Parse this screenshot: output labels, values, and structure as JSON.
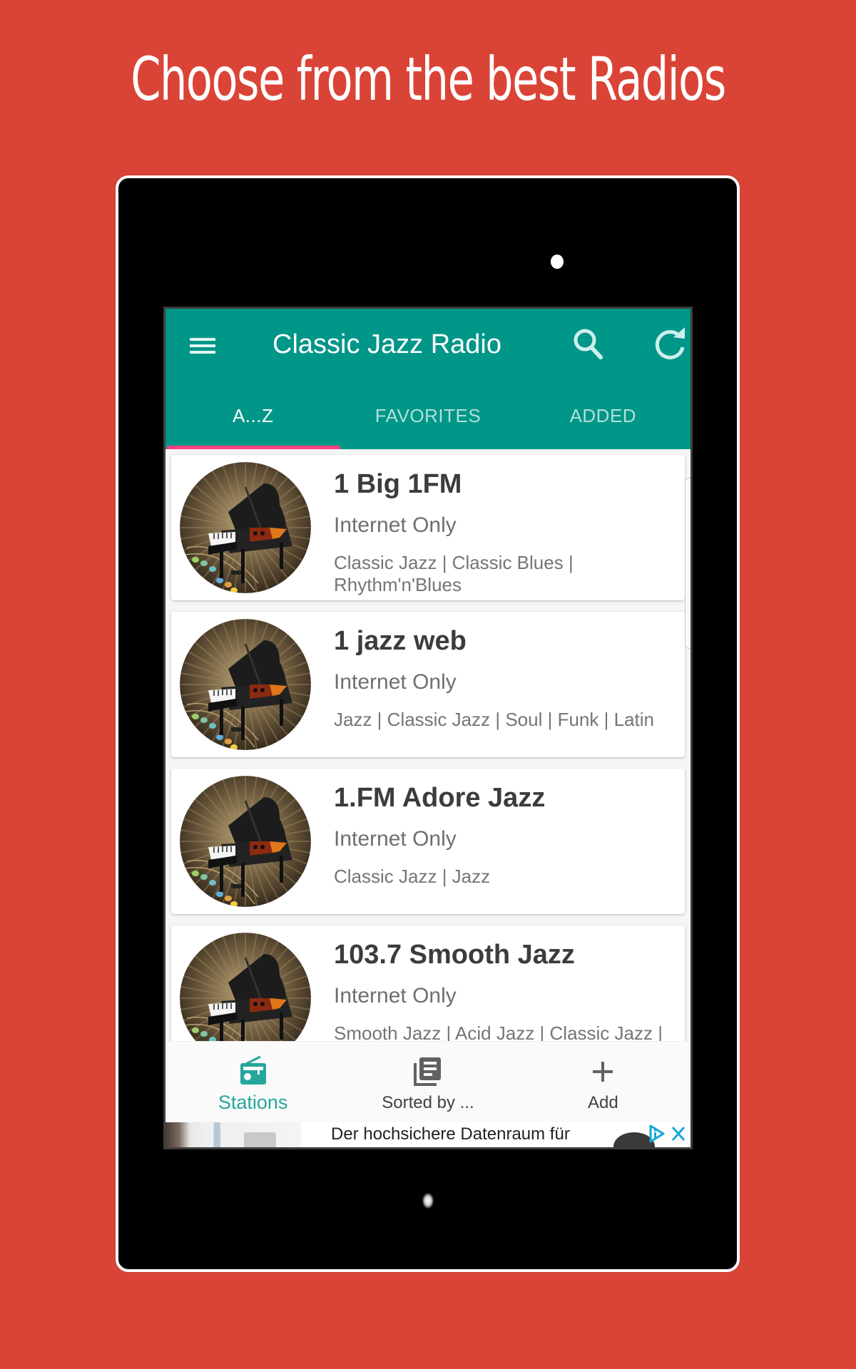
{
  "promo": {
    "headline": "Choose from the best Radios"
  },
  "app": {
    "title": "Classic Jazz Radio",
    "colors": {
      "primary": "#009688",
      "accent": "#FF4081",
      "background": "#DA4437",
      "active_nav": "#26A69A"
    },
    "toolbar": {
      "menu_icon": "hamburger-menu-icon",
      "search_icon": "search-icon",
      "refresh_icon": "refresh-icon"
    },
    "tabs": [
      {
        "label": "A...Z",
        "active": true
      },
      {
        "label": "FAVORITES",
        "active": false
      },
      {
        "label": "ADDED",
        "active": false
      }
    ]
  },
  "stations": [
    {
      "name": "1 Big 1FM",
      "location": "Internet Only",
      "genres": "Classic Jazz | Classic Blues | Rhythm'n'Blues",
      "logo": "grand-piano-logo"
    },
    {
      "name": "1 jazz web",
      "location": "Internet Only",
      "genres": "Jazz | Classic Jazz | Soul | Funk | Latin",
      "logo": "grand-piano-logo"
    },
    {
      "name": "1.FM Adore Jazz",
      "location": "Internet Only",
      "genres": "Classic Jazz | Jazz",
      "logo": "grand-piano-logo"
    },
    {
      "name": "103.7 Smooth Jazz",
      "location": "Internet Only",
      "genres": "Smooth Jazz | Acid Jazz | Classic Jazz |",
      "logo": "grand-piano-logo"
    }
  ],
  "bottom_nav": [
    {
      "label": "Stations",
      "icon": "radio-icon",
      "active": true
    },
    {
      "label": "Sorted by ...",
      "icon": "library-books-icon",
      "active": false
    },
    {
      "label": "Add",
      "icon": "plus-icon",
      "active": false
    }
  ],
  "ad": {
    "text": "Der hochsichere Datenraum für",
    "choices_icon": "ad-choices-icon",
    "close_icon": "close-icon"
  }
}
